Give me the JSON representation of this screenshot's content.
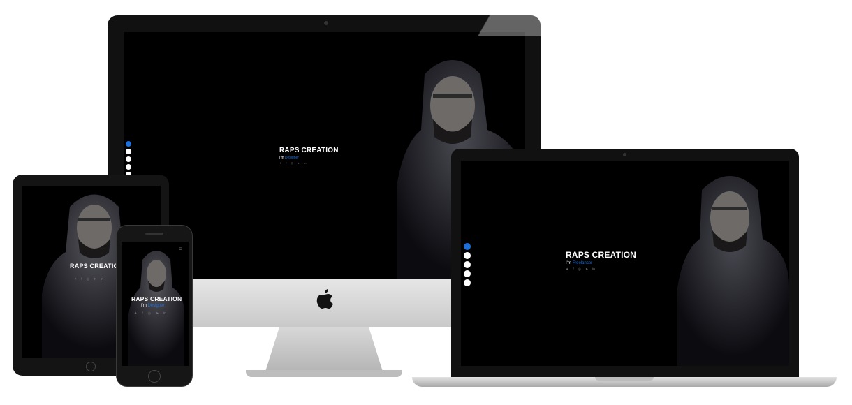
{
  "brand": "RAPS CREATION",
  "prefix": "I'm",
  "roles": {
    "desktop": "Designer",
    "laptop": "Freelancer",
    "phone": "Designer"
  },
  "social_icons": [
    "twitter-icon",
    "facebook-icon",
    "instagram-icon",
    "telegram-icon",
    "linkedin-icon"
  ],
  "social_glyphs": [
    "✦",
    "f",
    "◎",
    "➤",
    "in"
  ],
  "nav_dots": [
    "home",
    "about",
    "resume",
    "portfolio",
    "contact"
  ],
  "menu_glyph": "≡",
  "colors": {
    "accent": "#1e6fd9",
    "screen": "#000000",
    "bezel": "#1a1a1a",
    "silver": "#cfcfcf"
  }
}
